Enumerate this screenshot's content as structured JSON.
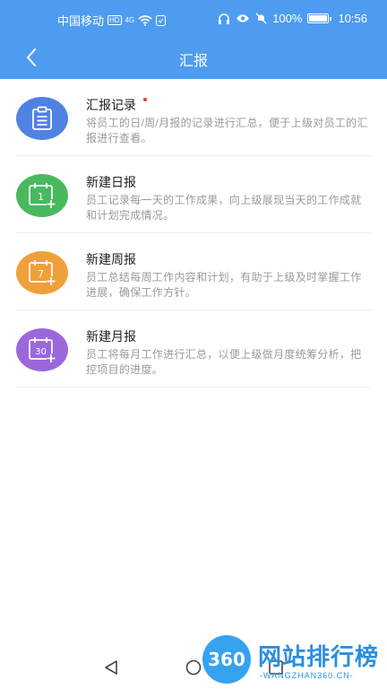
{
  "status_bar": {
    "carrier": "中国移动",
    "hd_badge": "HD",
    "network": "4G",
    "battery_pct": "100%",
    "time": "10:56"
  },
  "header": {
    "title": "汇报",
    "back_icon": "chevron-left-icon"
  },
  "colors": {
    "header_bg": "#4d9cf0",
    "blue": "#4f82e3",
    "green": "#4ab85f",
    "orange": "#f0a03a",
    "purple": "#9b68dc",
    "unread_dot": "#e53935"
  },
  "items": [
    {
      "title": "汇报记录",
      "desc": "将员工的日/周/月报的记录进行汇总，便于上级对员工的汇报进行查看。",
      "icon": "clipboard-icon",
      "has_dot": true
    },
    {
      "title": "新建日报",
      "desc": "员工记录每一天的工作成果，向上级展现当天的工作成就和计划完成情况。",
      "icon": "calendar-1-add-icon",
      "icon_text": "1"
    },
    {
      "title": "新建周报",
      "desc": "员工总结每周工作内容和计划，有助于上级及时掌握工作进展，确保工作方针。",
      "icon": "calendar-7-add-icon",
      "icon_text": "7"
    },
    {
      "title": "新建月报",
      "desc": "员工将每月工作进行汇总，以便上级做月度统筹分析，把控项目的进度。",
      "icon": "calendar-30-add-icon",
      "icon_text": "30"
    }
  ],
  "watermark": {
    "logo_text": "360",
    "title": "网站排行榜",
    "subtitle": "-WANGZHAN360.CN-"
  }
}
